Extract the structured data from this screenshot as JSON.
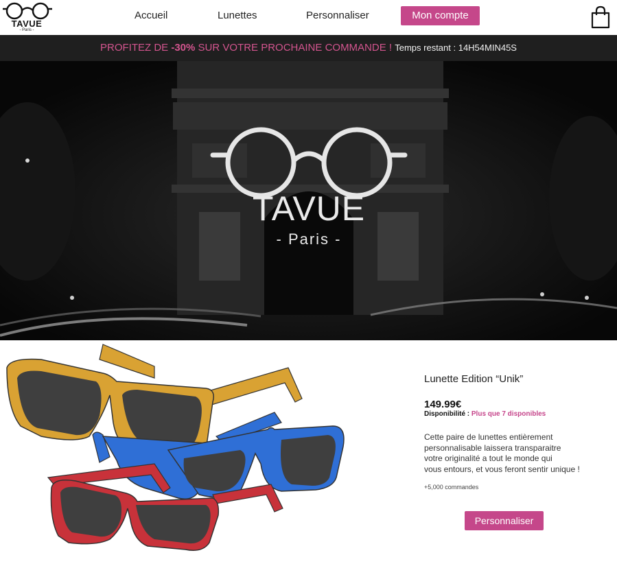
{
  "colors": {
    "accent": "#c5478a",
    "promo_bg": "#1f1f1f",
    "hero_bg": "#0a0a0a",
    "frame_yellow": "#d9a233",
    "frame_blue": "#2f6fd6",
    "frame_red": "#c8323a",
    "lens": "#3f3f3f"
  },
  "header": {
    "logo_text": "TAVUE",
    "logo_sub": "- Paris -",
    "logo_icon": "glasses-icon",
    "nav": {
      "accueil": "Accueil",
      "lunettes": "Lunettes",
      "personnaliser": "Personnaliser"
    },
    "account_label": "Mon compte",
    "cart_icon": "shopping-bag-icon"
  },
  "promo": {
    "text_a": "PROFITEZ DE ",
    "text_b": "-30%",
    "text_c": " SUR VOTRE PROCHAINE COMMANDE ! ",
    "timer": "Temps restant : 14H54MIN45S"
  },
  "hero": {
    "brand": "TAVUE",
    "sub": "- Paris -"
  },
  "product": {
    "title": "Lunette Edition “Unik”",
    "price": "149.99€",
    "availability_label": "Disponibilité : ",
    "availability_value": "Plus que 7 disponibles",
    "description": [
      "Cette paire de lunettes entièrement",
      "personnalisable laissera  transparaitre",
      "votre originalité a tout le monde qui",
      "vous entours, et vous feront sentir unique !"
    ],
    "orders": "+5,000 commandes",
    "button_label": "Personnaliser"
  }
}
